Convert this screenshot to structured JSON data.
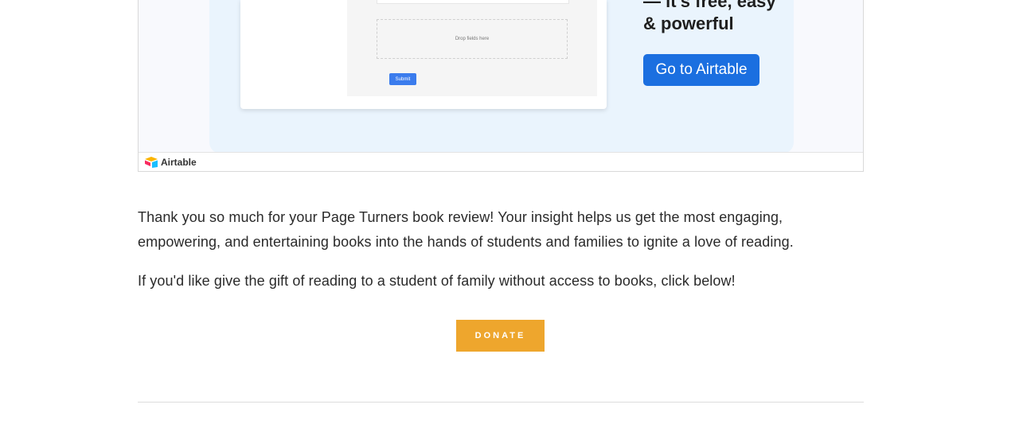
{
  "embed": {
    "form_preview": {
      "drop_zone_text": "Drop fields here",
      "submit_label": "Submit"
    },
    "promo": {
      "line1": "— it's free, easy",
      "line2": "& powerful",
      "cta_label": "Go to Airtable"
    },
    "footer": {
      "brand": "Airtable",
      "logo_icon": "airtable-logo-icon"
    }
  },
  "content": {
    "paragraph1": "Thank you so much for your Page Turners book review! Your insight helps us get the most engaging, empowering, and entertaining books into the hands of students and families to ignite a love of reading.",
    "paragraph2": "If you'd like give the gift of reading to a student of family without access to books, click below!",
    "donate_label": "DONATE"
  },
  "colors": {
    "cta_blue": "#1b6fe0",
    "donate_orange": "#eea62d",
    "promo_bg": "#eaf4fd"
  }
}
